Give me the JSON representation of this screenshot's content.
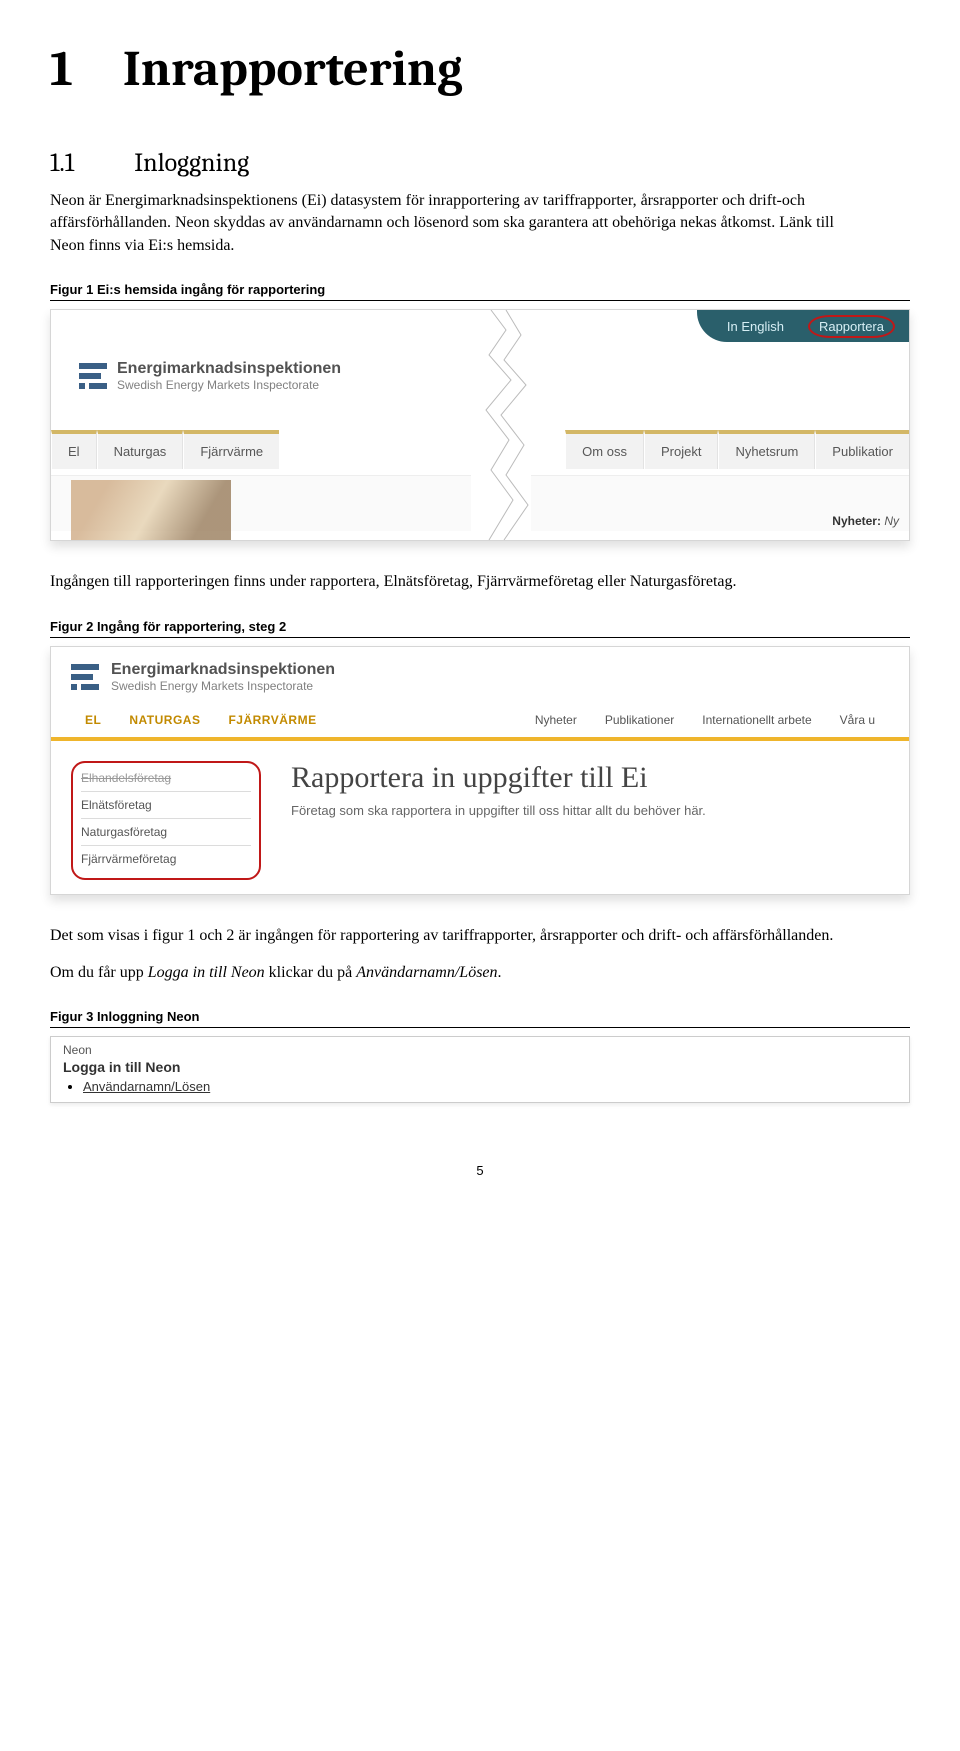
{
  "h1": {
    "num": "1",
    "title": "Inrapportering"
  },
  "h2": {
    "num": "1.1",
    "title": "Inloggning"
  },
  "para1": "Neon är Energimarknadsinspektionens (Ei) datasystem för inrapportering av tariffrapporter, årsrapporter och drift-och affärsförhållanden. Neon skyddas av användarnamn och lösenord som ska garantera att obehöriga nekas åtkomst. Länk till Neon finns via Ei:s hemsida.",
  "caption1": "Figur 1 Ei:s hemsida ingång för rapportering",
  "fig1": {
    "top_links": [
      "In English",
      "Rapportera"
    ],
    "logo_title": "Energimarknadsinspektionen",
    "logo_sub": "Swedish Energy Markets Inspectorate",
    "tabs_left": [
      "El",
      "Naturgas",
      "Fjärrvärme"
    ],
    "tabs_right": [
      "Om oss",
      "Projekt",
      "Nyhetsrum",
      "Publikatior"
    ],
    "news_label": "Nyheter:",
    "news_text": "Ny"
  },
  "para2": "Ingången till rapporteringen finns under rapportera, Elnätsföretag, Fjärrvärmeföretag eller Naturgasföretag.",
  "caption2": "Figur 2 Ingång för rapportering, steg 2",
  "fig2": {
    "logo_title": "Energimarknadsinspektionen",
    "logo_sub": "Swedish Energy Markets Inspectorate",
    "tabs_left": [
      "EL",
      "NATURGAS",
      "FJÄRRVÄRME"
    ],
    "tabs_right": [
      "Nyheter",
      "Publikationer",
      "Internationellt arbete",
      "Våra u"
    ],
    "sidebar": [
      "Elhandelsföretag",
      "Elnätsföretag",
      "Naturgasföretag",
      "Fjärrvärmeföretag"
    ],
    "main_title": "Rapportera in uppgifter till Ei",
    "main_text": "Företag som ska rapportera in uppgifter till oss hittar allt du behöver här."
  },
  "para3a": "Det som visas i figur 1 och 2 är ingången för rapportering av tariffrapporter, årsrapporter och drift- och affärsförhållanden.",
  "para3b_pre": "Om du får upp ",
  "para3b_i1": "Logga in till Neon",
  "para3b_mid": " klickar du på ",
  "para3b_i2": "Användarnamn/Lösen",
  "para3b_suf": ".",
  "caption3": "Figur 3 Inloggning Neon",
  "fig3": {
    "neon": "Neon",
    "login": "Logga in till Neon",
    "link": "Användarnamn/Lösen"
  },
  "page": "5"
}
